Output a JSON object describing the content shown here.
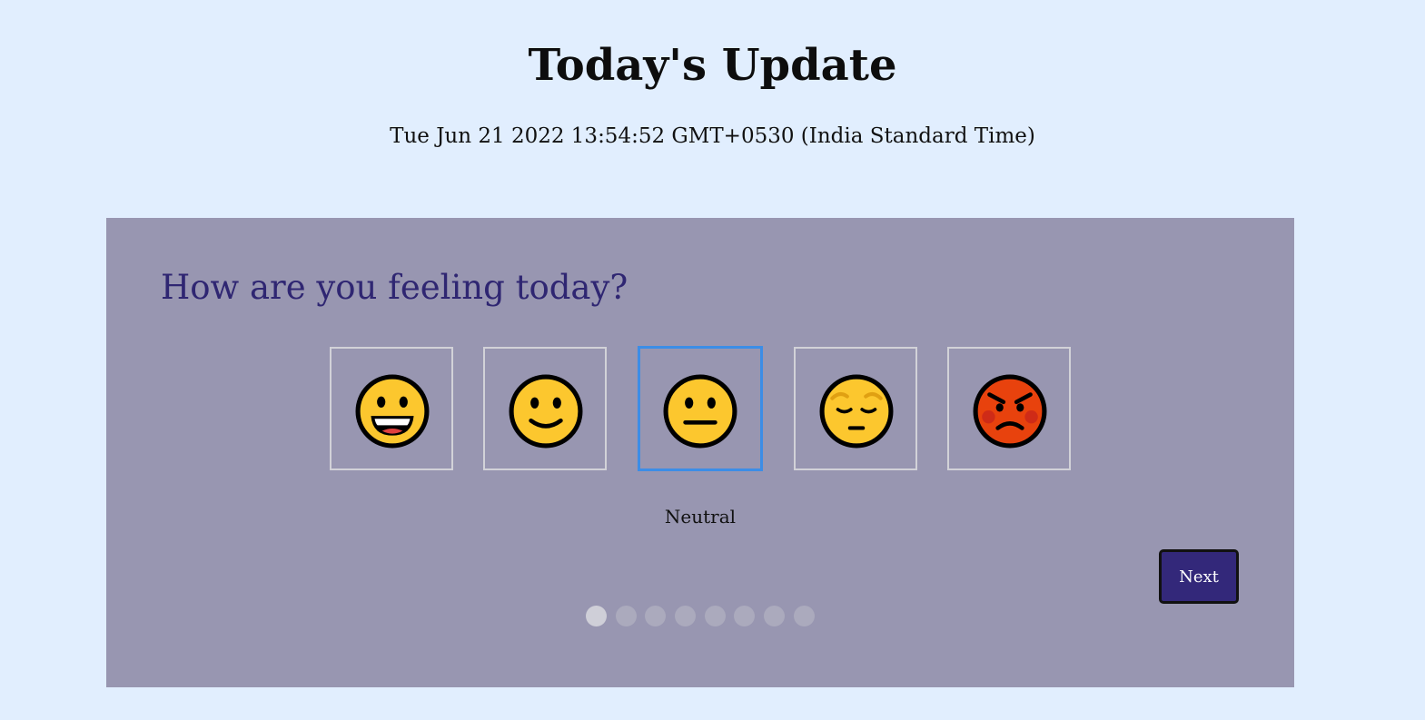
{
  "header": {
    "title": "Today's Update",
    "timestamp": "Tue Jun 21 2022 13:54:52 GMT+0530 (India Standard Time)"
  },
  "card": {
    "question": "How are you feeling today?",
    "selected_mood_label": "Neutral",
    "next_label": "Next",
    "moods": [
      {
        "icon": "grinning-face-icon",
        "selected": false
      },
      {
        "icon": "slightly-smiling-face-icon",
        "selected": false
      },
      {
        "icon": "neutral-face-icon",
        "selected": true
      },
      {
        "icon": "pensive-face-icon",
        "selected": false
      },
      {
        "icon": "angry-face-icon",
        "selected": false
      }
    ],
    "pagination": {
      "total": 8,
      "current": 1
    }
  },
  "colors": {
    "page_background": "#e1eefe",
    "card_background": "#9896b1",
    "question_color": "#2f2672",
    "button_background": "#33287a",
    "selected_border": "#3c8de6",
    "emoji_yellow": "#fcc72e",
    "emoji_red": "#e8420d"
  }
}
